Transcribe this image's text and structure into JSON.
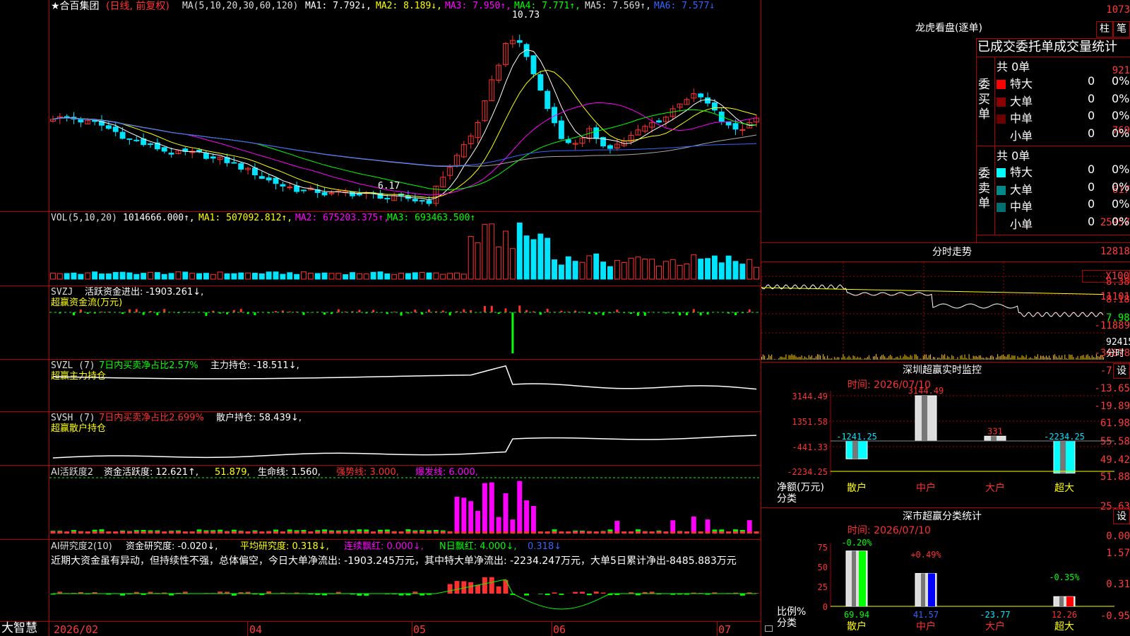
{
  "colors": {
    "up": "#ff3030",
    "down": "#00e5ff",
    "grid": "#b00000",
    "yellow": "#ffff00",
    "magenta": "#ff00ff",
    "green": "#00ff00",
    "white": "#ffffff",
    "blue": "#3366ff"
  },
  "main": {
    "title": "★合百集团",
    "mode": "(日线, 前复权)",
    "ma_label": "MA(5,10,20,30,60,120)",
    "ma1": "MA1: 7.792↓,",
    "ma2": "MA2: 8.189↓,",
    "ma3": "MA3: 7.950↑,",
    "ma4": "MA4: 7.771↑,",
    "ma5": "MA5: 7.569↑,",
    "ma6": "MA6: 7.577↓",
    "y_ticks": [
      "1073",
      "921",
      "769",
      "617"
    ],
    "high_label": "10.73",
    "low_label": "6.17",
    "high_value": 10.73,
    "low_value": 6.17
  },
  "vol": {
    "label": "VOL(5,10,20)",
    "v": "1014666.000↑,",
    "ma1": "MA1: 507092.812↑,",
    "ma2": "MA2: 675203.375↑,",
    "ma3": "MA3: 693463.500↑",
    "y_ticks": [
      "25957",
      "12818",
      "X100"
    ]
  },
  "svzj": {
    "label": "SVZJ",
    "l1": "活跃资金进出: -1903.261↓,",
    "l2": "超赢资金流(万元)",
    "y_ticks": [
      "11101",
      "-11889",
      "-34878"
    ]
  },
  "svzl": {
    "label": "SVZL (7)",
    "l1": "7日内买卖净占比2.57%",
    "l2": "主力持仓: -18.511↓,",
    "l3": "超赢主力持仓",
    "y_ticks": [
      "-7.42",
      "-13.65",
      "-19.89"
    ]
  },
  "svsh": {
    "label": "SVSH (7)",
    "l1": "7日内买卖净占比2.699%",
    "l2": "散户持仓: 58.439↓,",
    "l3": "超赢散户持仓",
    "y_ticks": [
      "61.98",
      "55.58",
      "49.42"
    ]
  },
  "ai1": {
    "label": "AI活跃度2",
    "l1": "资金活跃度: 12.621↑,",
    "l2": "51.879,",
    "l3": "生命线: 1.560,",
    "l4": "强势线: 3.000,",
    "l5": "爆发线: 6.000,",
    "y_ticks": [
      "51.88",
      "25.63",
      "0.00"
    ]
  },
  "ai2": {
    "label": "AI研究度2(10)",
    "l1": "资金研究度: -0.020↓,",
    "l2": "平均研究度: 0.318↓,",
    "l3": "连续飘红: 0.000↓,",
    "l4": "N日飘红: 4.000↓,",
    "l5": "0.318↓",
    "comment": "近期大资金虽有异动，但持续性不强，总体偏空，今日大单净流出: -1903.245万元，其中特大单净流出: -2234.247万元，大单5日累计净出-8485.883万元",
    "y_ticks": [
      "1.57",
      "0.31",
      "-0.95"
    ]
  },
  "xaxis": {
    "logo": "大智慧",
    "labels": [
      "2026/02",
      "04",
      "05",
      "06",
      "07"
    ]
  },
  "lhb": {
    "title": "龙虎看盘(逐单)",
    "btn1": "柱",
    "btn2": "笔",
    "header": "已成交委托单成交量统计",
    "buy_label": "委买单",
    "sell_label": "委卖单",
    "buy_total": "共 0单",
    "sell_total": "共 0单",
    "rows": [
      {
        "name": "特大",
        "count": "0",
        "pct": "0%"
      },
      {
        "name": "大单",
        "count": "0",
        "pct": "0%"
      },
      {
        "name": "中单",
        "count": "0",
        "pct": "0%"
      },
      {
        "name": "小单",
        "count": "0",
        "pct": "0%"
      }
    ]
  },
  "fenshi": {
    "title": "分时走势",
    "y_ticks": [
      "8.38",
      "8.18",
      "7.98"
    ],
    "vol_tick": "92415",
    "tab": "分时"
  },
  "szmon": {
    "title": "深圳超赢实时监控",
    "btn": "设",
    "time": "时间: 2026/07/10",
    "y_ticks": [
      "3144.49",
      "1351.58",
      "-441.33",
      "-2234.25"
    ],
    "y_label": "净额(万元)",
    "x_label": "分类",
    "cats": [
      "散户",
      "中户",
      "大户",
      "超大"
    ],
    "bar_values": [
      -1241.25,
      3144.49,
      331,
      -2234.25
    ],
    "bar_labels": [
      "-1241.25",
      "3144.49",
      "331",
      "-2234.25"
    ]
  },
  "szcls": {
    "title": "深市超赢分类统计",
    "btn": "设",
    "time": "时间: 2026/07/10",
    "y_ticks": [
      "75",
      "50",
      "25",
      "0"
    ],
    "y_label": "比例%",
    "x_label": "分类",
    "cats": [
      "散户",
      "中户",
      "大户",
      "超大"
    ],
    "bar_values": [
      69.94,
      41.57,
      -23.77,
      12.26
    ],
    "bar_labels": [
      "69.94",
      "41.57",
      "-23.77",
      "12.26"
    ],
    "changes": [
      "-0.20%",
      "+0.49%",
      "-0.35%"
    ]
  }
}
